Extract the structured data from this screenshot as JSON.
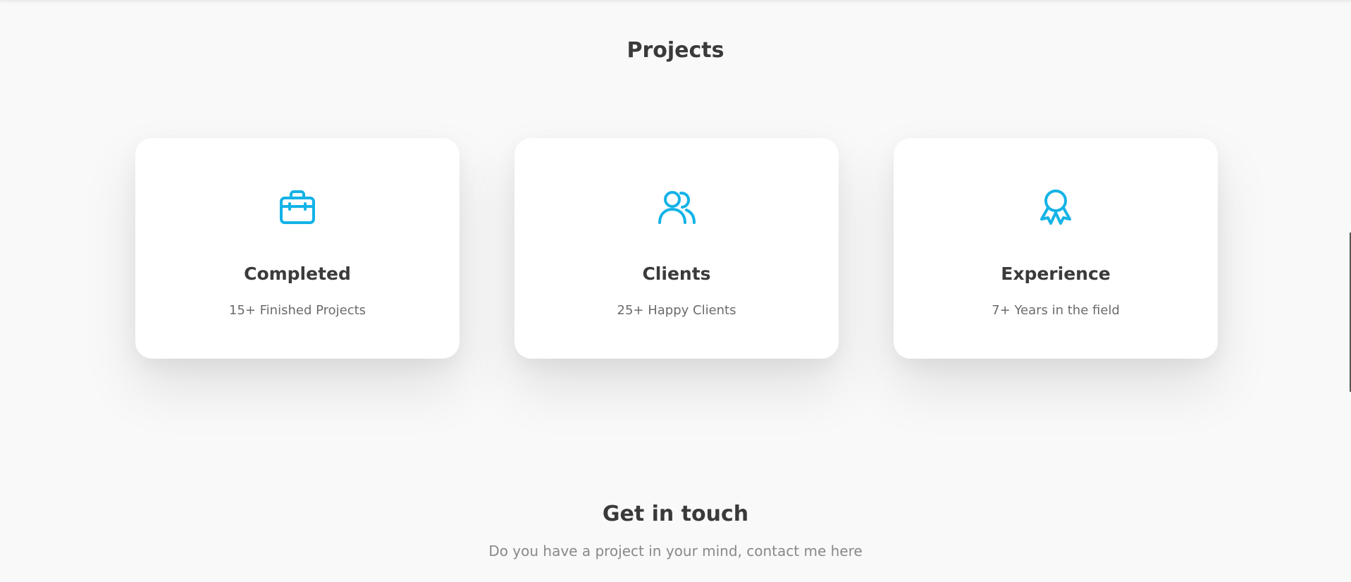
{
  "section": {
    "title": "Projects"
  },
  "accent_color": "#14b3e6",
  "cards": [
    {
      "icon": "briefcase-icon",
      "title": "Completed",
      "subtitle": "15+ Finished Projects"
    },
    {
      "icon": "users-icon",
      "title": "Clients",
      "subtitle": "25+ Happy Clients"
    },
    {
      "icon": "award-icon",
      "title": "Experience",
      "subtitle": "7+ Years in the field"
    }
  ],
  "contact": {
    "title": "Get in touch",
    "subtitle": "Do you have a project in your mind, contact me here"
  }
}
